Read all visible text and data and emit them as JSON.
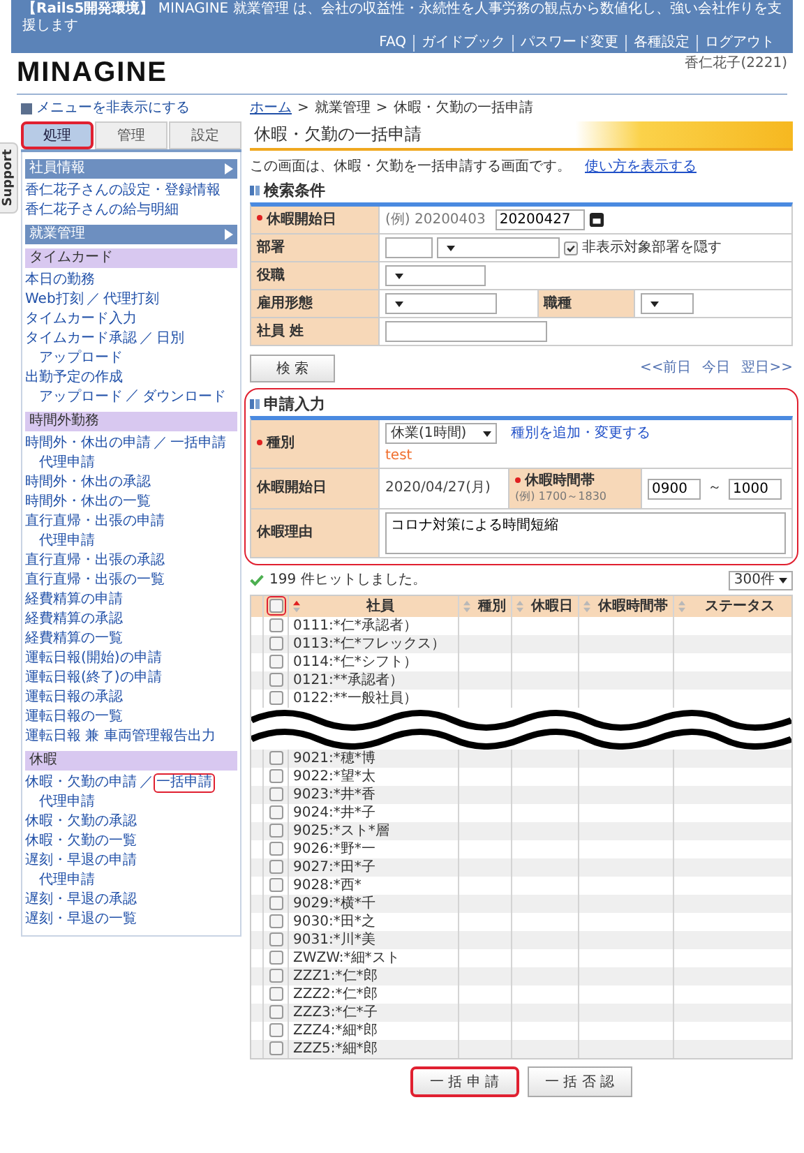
{
  "top_bar": {
    "tagline": "**【Rails5開発環境】** MINAGINE 就業管理 は、会社の収益性・永続性を人事労務の観点から数値化し、強い会社作りを支援します",
    "links": [
      "FAQ",
      "ガイドブック",
      "パスワード変更",
      "各種設定",
      "ログアウト"
    ]
  },
  "logo": "MINAGINE",
  "user": "香仁花子(2221)",
  "sidebar": {
    "toggle": "メニューを非表示にする",
    "support_tab": "Support",
    "separator": "／",
    "tabs": [
      {
        "label": "処理",
        "selected": true,
        "highlighted": true
      },
      {
        "label": "管理",
        "selected": false,
        "highlighted": false
      },
      {
        "label": "設定",
        "selected": false,
        "highlighted": false
      }
    ],
    "items": [
      {
        "kind": "header",
        "label": "社員情報"
      },
      {
        "kind": "link",
        "links": [
          {
            "label": "香仁花子さんの設定・登録情報",
            "highlighted": false
          }
        ]
      },
      {
        "kind": "link",
        "links": [
          {
            "label": "香仁花子さんの給与明細",
            "highlighted": false
          }
        ]
      },
      {
        "kind": "header",
        "label": "就業管理"
      },
      {
        "kind": "group",
        "label": "タイムカード"
      },
      {
        "kind": "link",
        "links": [
          {
            "label": "本日の勤務",
            "highlighted": false
          }
        ]
      },
      {
        "kind": "link",
        "links": [
          {
            "label": "Web打刻",
            "highlighted": false
          },
          {
            "label": "代理打刻",
            "highlighted": false
          }
        ]
      },
      {
        "kind": "link",
        "links": [
          {
            "label": "タイムカード入力",
            "highlighted": false
          }
        ]
      },
      {
        "kind": "link",
        "links": [
          {
            "label": "タイムカード承認",
            "highlighted": false
          },
          {
            "label": "日別",
            "highlighted": false
          }
        ],
        "children": [
          {
            "links": [
              {
                "label": "アップロード",
                "highlighted": false
              }
            ]
          }
        ]
      },
      {
        "kind": "link",
        "links": [
          {
            "label": "出勤予定の作成",
            "highlighted": false
          }
        ],
        "children": [
          {
            "links": [
              {
                "label": "アップロード",
                "highlighted": false
              },
              {
                "label": "ダウンロード",
                "highlighted": false
              }
            ]
          }
        ]
      },
      {
        "kind": "group",
        "label": "時間外勤務"
      },
      {
        "kind": "link",
        "links": [
          {
            "label": "時間外・休出の申請",
            "highlighted": false
          },
          {
            "label": "一括申請",
            "highlighted": false
          }
        ],
        "children": [
          {
            "links": [
              {
                "label": "代理申請",
                "highlighted": false
              }
            ]
          }
        ]
      },
      {
        "kind": "link",
        "links": [
          {
            "label": "時間外・休出の承認",
            "highlighted": false
          }
        ]
      },
      {
        "kind": "link",
        "links": [
          {
            "label": "時間外・休出の一覧",
            "highlighted": false
          }
        ]
      },
      {
        "kind": "link",
        "links": [
          {
            "label": "直行直帰・出張の申請",
            "highlighted": false
          }
        ],
        "children": [
          {
            "links": [
              {
                "label": "代理申請",
                "highlighted": false
              }
            ]
          }
        ]
      },
      {
        "kind": "link",
        "links": [
          {
            "label": "直行直帰・出張の承認",
            "highlighted": false
          }
        ]
      },
      {
        "kind": "link",
        "links": [
          {
            "label": "直行直帰・出張の一覧",
            "highlighted": false
          }
        ]
      },
      {
        "kind": "link",
        "links": [
          {
            "label": "経費精算の申請",
            "highlighted": false
          }
        ]
      },
      {
        "kind": "link",
        "links": [
          {
            "label": "経費精算の承認",
            "highlighted": false
          }
        ]
      },
      {
        "kind": "link",
        "links": [
          {
            "label": "経費精算の一覧",
            "highlighted": false
          }
        ]
      },
      {
        "kind": "link",
        "links": [
          {
            "label": "運転日報(開始)の申請",
            "highlighted": false
          }
        ]
      },
      {
        "kind": "link",
        "links": [
          {
            "label": "運転日報(終了)の申請",
            "highlighted": false
          }
        ]
      },
      {
        "kind": "link",
        "links": [
          {
            "label": "運転日報の承認",
            "highlighted": false
          }
        ]
      },
      {
        "kind": "link",
        "links": [
          {
            "label": "運転日報の一覧",
            "highlighted": false
          }
        ]
      },
      {
        "kind": "link",
        "links": [
          {
            "label": "運転日報 兼 車両管理報告出力",
            "highlighted": false
          }
        ]
      },
      {
        "kind": "group",
        "label": "休暇"
      },
      {
        "kind": "link",
        "links": [
          {
            "label": "休暇・欠勤の申請",
            "highlighted": false
          },
          {
            "label": "一括申請",
            "highlighted": true
          }
        ],
        "children": [
          {
            "links": [
              {
                "label": "代理申請",
                "highlighted": false
              }
            ]
          }
        ]
      },
      {
        "kind": "link",
        "links": [
          {
            "label": "休暇・欠勤の承認",
            "highlighted": false
          }
        ]
      },
      {
        "kind": "link",
        "links": [
          {
            "label": "休暇・欠勤の一覧",
            "highlighted": false
          }
        ]
      },
      {
        "kind": "link",
        "links": [
          {
            "label": "遅刻・早退の申請",
            "highlighted": false
          }
        ],
        "children": [
          {
            "links": [
              {
                "label": "代理申請",
                "highlighted": false
              }
            ]
          }
        ]
      },
      {
        "kind": "link",
        "links": [
          {
            "label": "遅刻・早退の承認",
            "highlighted": false
          }
        ]
      },
      {
        "kind": "link",
        "links": [
          {
            "label": "遅刻・早退の一覧",
            "highlighted": false
          }
        ]
      }
    ]
  },
  "breadcrumb": [
    {
      "label": "ホーム",
      "link": true
    },
    {
      "label": "就業管理",
      "link": false
    },
    {
      "label": "休暇・欠勤の一括申請",
      "link": false
    }
  ],
  "breadcrumb_separator": ">",
  "page_title": "休暇・欠勤の一括申請",
  "description": "この画面は、休暇・欠勤を一括申請する画面です。",
  "help_link": "使い方を表示する",
  "search": {
    "title": "検索条件",
    "start_date": {
      "label": "休暇開始日",
      "required": true,
      "hint": "(例) 20200403",
      "value": "20200427"
    },
    "department": {
      "label": "部署",
      "required": false,
      "checkbox": {
        "label": "非表示対象部署を隠す",
        "checked": true
      }
    },
    "position": {
      "label": "役職",
      "required": false
    },
    "employment": {
      "label": "雇用形態",
      "required": false
    },
    "job_type": {
      "label": "職種",
      "required": false
    },
    "last_name": {
      "label": "社員 姓",
      "required": false
    },
    "button": "検 索",
    "nav": [
      "<<前日",
      "今日",
      "翌日>>"
    ]
  },
  "apply": {
    "title": "申請入力",
    "highlighted": true,
    "type": {
      "label": "種別",
      "required": true,
      "value": "休業(1時間)",
      "link": "種別を追加・変更する",
      "note": "test"
    },
    "start_date": {
      "label": "休暇開始日",
      "required": false,
      "value": "2020/04/27(月)"
    },
    "time": {
      "label": "休暇時間帯",
      "required": true,
      "hint": "(例) 1700～1830",
      "from": "0900",
      "separator": "～",
      "to": "1000"
    },
    "reason": {
      "label": "休暇理由",
      "required": false,
      "value": "コロナ対策による時間短縮"
    }
  },
  "results": {
    "message": "199 件ヒットしました。",
    "per_page": "300件",
    "header_checkbox": {
      "checked": false,
      "highlighted": true
    },
    "columns": [
      {
        "label": "社員",
        "sorted": true
      },
      {
        "label": "種別",
        "sorted": false
      },
      {
        "label": "休暇日",
        "sorted": false
      },
      {
        "label": "休暇時間帯",
        "sorted": false
      },
      {
        "label": "ステータス",
        "sorted": false
      }
    ],
    "rows_top": [
      {
        "name": "0111:*仁*承認者）",
        "checked": false
      },
      {
        "name": "0113:*仁*フレックス）",
        "checked": false
      },
      {
        "name": "0114:*仁*シフト）",
        "checked": false
      },
      {
        "name": "0121:**承認者）",
        "checked": false
      },
      {
        "name": "0122:**一般社員）",
        "checked": false
      }
    ],
    "rows_bottom": [
      {
        "name": "9021:*穂*博",
        "checked": false
      },
      {
        "name": "9022:*望*太",
        "checked": false
      },
      {
        "name": "9023:*井*香",
        "checked": false
      },
      {
        "name": "9024:*井*子",
        "checked": false
      },
      {
        "name": "9025:*スト*層",
        "checked": false
      },
      {
        "name": "9026:*野*一",
        "checked": false
      },
      {
        "name": "9027:*田*子",
        "checked": false
      },
      {
        "name": "9028:*西*",
        "checked": false
      },
      {
        "name": "9029:*横*千",
        "checked": false
      },
      {
        "name": "9030:*田*之",
        "checked": false
      },
      {
        "name": "9031:*川*美",
        "checked": false
      },
      {
        "name": "ZWZW:*細*スト",
        "checked": false
      },
      {
        "name": "ZZZ1:*仁*郎",
        "checked": false
      },
      {
        "name": "ZZZ2:*仁*郎",
        "checked": false
      },
      {
        "name": "ZZZ3:*仁*子",
        "checked": false
      },
      {
        "name": "ZZZ4:*細*郎",
        "checked": false
      },
      {
        "name": "ZZZ5:*細*郎",
        "checked": false
      }
    ]
  },
  "buttons": [
    {
      "label": "一 括 申 請",
      "highlighted": true
    },
    {
      "label": "一 括 否 認",
      "highlighted": false
    }
  ]
}
